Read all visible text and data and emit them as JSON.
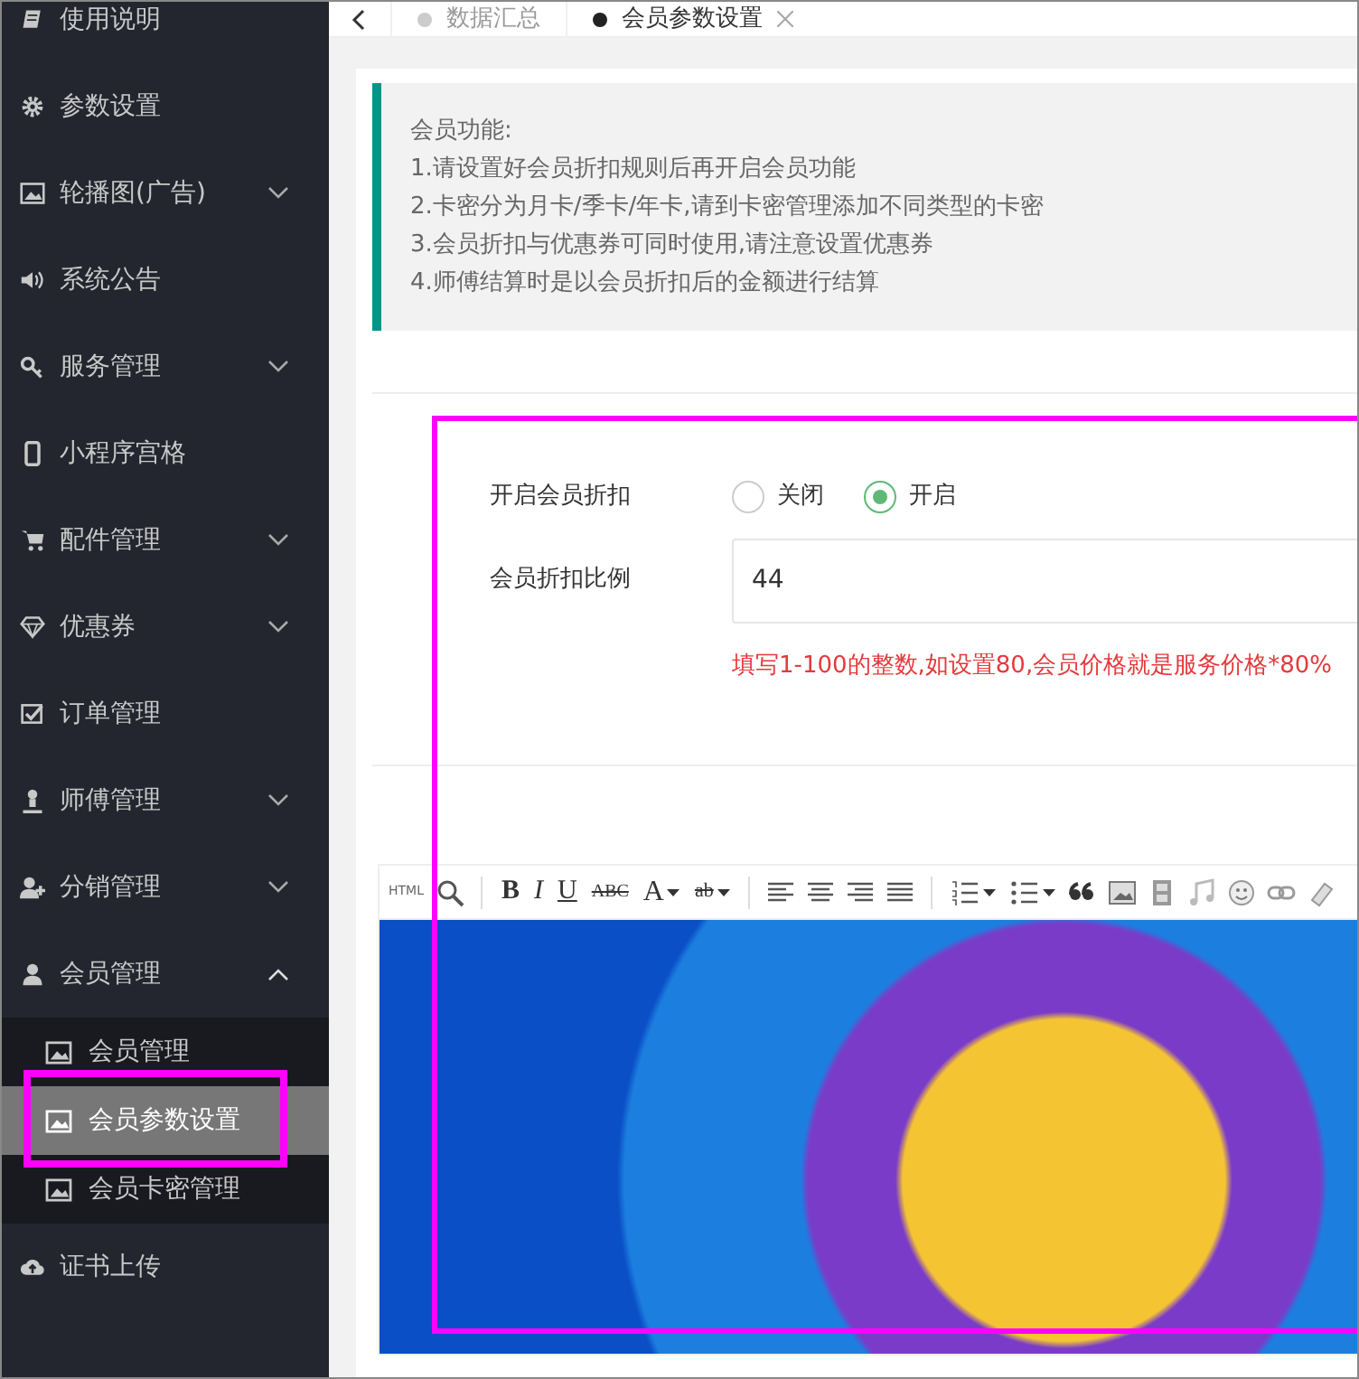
{
  "sidebar": {
    "items": [
      {
        "label": "使用说明",
        "kind": "link"
      },
      {
        "label": "参数设置",
        "kind": "link"
      },
      {
        "label": "轮播图(广告)",
        "kind": "group",
        "expanded": false
      },
      {
        "label": "系统公告",
        "kind": "link"
      },
      {
        "label": "服务管理",
        "kind": "group",
        "expanded": false
      },
      {
        "label": "小程序宫格",
        "kind": "link"
      },
      {
        "label": "配件管理",
        "kind": "group",
        "expanded": false
      },
      {
        "label": "优惠券",
        "kind": "group",
        "expanded": false
      },
      {
        "label": "订单管理",
        "kind": "link"
      },
      {
        "label": "师傅管理",
        "kind": "group",
        "expanded": false
      },
      {
        "label": "分销管理",
        "kind": "group",
        "expanded": false
      },
      {
        "label": "会员管理",
        "kind": "group",
        "expanded": true,
        "children": [
          {
            "label": "会员管理",
            "selected": false,
            "highlighted": false
          },
          {
            "label": "会员参数设置",
            "selected": true,
            "highlighted": true
          },
          {
            "label": "会员卡密管理",
            "selected": false,
            "highlighted": false
          }
        ]
      },
      {
        "label": "证书上传",
        "kind": "link"
      }
    ]
  },
  "tabs": [
    {
      "label": "数据汇总",
      "selected": false,
      "closable": false
    },
    {
      "label": "会员参数设置",
      "selected": true,
      "closable": true
    }
  ],
  "notice": {
    "lines": [
      "会员功能:",
      "1.请设置好会员折扣规则后再开启会员功能",
      "2.卡密分为月卡/季卡/年卡,请到卡密管理添加不同类型的卡密",
      "3.会员折扣与优惠券可同时使用,请注意设置优惠券",
      "4.师傅结算时是以会员折扣后的金额进行结算"
    ]
  },
  "form": {
    "highlighted": true,
    "discount_switch": {
      "label": "开启会员折扣",
      "options": [
        {
          "label": "关闭",
          "selected": false
        },
        {
          "label": "开启",
          "selected": true
        }
      ]
    },
    "discount_ratio": {
      "label": "会员折扣比例",
      "value": "44",
      "hint": "填写1-100的整数,如设置80,会员价格就是服务价格*80%"
    },
    "editor": {
      "toolbar": [
        {
          "kind": "text",
          "label": "HTML",
          "dropdown": false
        },
        {
          "kind": "icon",
          "dropdown": false
        },
        {
          "kind": "separator"
        },
        {
          "kind": "text",
          "label": "B",
          "dropdown": false
        },
        {
          "kind": "text",
          "label": "I",
          "dropdown": false
        },
        {
          "kind": "text",
          "label": "U",
          "dropdown": false
        },
        {
          "kind": "text",
          "label": "ABC",
          "dropdown": false
        },
        {
          "kind": "text",
          "label": "A",
          "dropdown": true
        },
        {
          "kind": "text",
          "label": "ab",
          "dropdown": true
        },
        {
          "kind": "separator"
        },
        {
          "kind": "icon",
          "dropdown": false
        },
        {
          "kind": "icon",
          "dropdown": false
        },
        {
          "kind": "icon",
          "dropdown": false
        },
        {
          "kind": "icon",
          "dropdown": false
        },
        {
          "kind": "separator"
        },
        {
          "kind": "icon",
          "dropdown": true
        },
        {
          "kind": "icon",
          "dropdown": true
        },
        {
          "kind": "icon",
          "dropdown": false
        },
        {
          "kind": "icon",
          "dropdown": false
        },
        {
          "kind": "icon",
          "dropdown": false
        },
        {
          "kind": "icon",
          "dropdown": false
        },
        {
          "kind": "icon",
          "dropdown": false
        },
        {
          "kind": "icon",
          "dropdown": false
        },
        {
          "kind": "icon",
          "dropdown": false
        }
      ]
    }
  }
}
